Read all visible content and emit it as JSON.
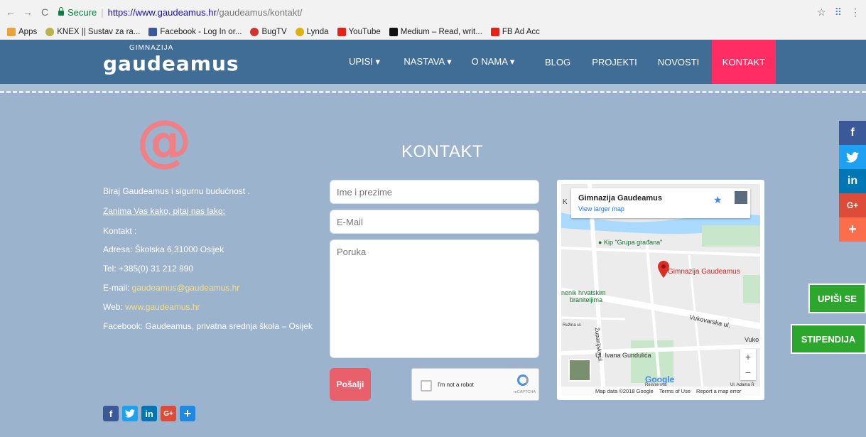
{
  "browser": {
    "secure_label": "Secure",
    "url_host": "https://www.gaudeamus.hr",
    "url_path": "/gaudeamus/kontakt/",
    "bookmarks": [
      "Apps",
      "KNEX || Sustav za ra...",
      "Facebook - Log In or...",
      "BugTV",
      "Lynda",
      "YouTube",
      "Medium – Read, writ...",
      "FB Ad Acc"
    ]
  },
  "header": {
    "logo_small": "GIMNAZIJA",
    "logo_big": "gaudeamus",
    "menu": [
      "UPISI ▾",
      "NASTAVA ▾",
      "O NAMA ▾",
      "BLOG",
      "PROJEKTI",
      "NOVOSTI",
      "KONTAKT"
    ]
  },
  "left": {
    "tagline": "Biraj Gaudeamus i sigurnu budućnost .",
    "ask_link": "Zanima Vas kako, pitaj nas lako:",
    "contact_label": "Kontakt :",
    "address": "Adresa: Školska 6,31000 Osijek",
    "tel": "Tel: +385(0) 31 212 890",
    "email_label": "E-mail: ",
    "email": "gaudeamus@gaudeamus.hr",
    "web_label": "Web: ",
    "web": "www.gaudeamus.hr",
    "facebook": "Facebook: Gaudeamus, privatna srednja škola – Osijek"
  },
  "form": {
    "title": "KONTAKT",
    "name_placeholder": "Ime i prezime",
    "email_placeholder": "E-Mail",
    "message_placeholder": "Poruka",
    "send_label": "Pošalji",
    "captcha_label": "I'm not a robot",
    "captcha_sub": "reCAPTCHA"
  },
  "map": {
    "place_title": "Gimnazija Gaudeamus",
    "larger_map": "View larger map",
    "k_label": "K",
    "poi_1": "Kip \"Grupa građana\"",
    "poi_red": "Gimnazija Gaudeamus",
    "poi_2a": "nenik hrvatskim",
    "poi_2b": "braniteljima",
    "street_1": "Vukovarska ul.",
    "street_1b": "Vuko",
    "street_2": "Ul. Ivana Gundulića",
    "street_3": "Ružina ul.",
    "street_4": "Županijska ul.",
    "street_5": "Reisnerova",
    "street_6": "Ul. Adama R",
    "google": "Google",
    "footer": [
      "Map data ©2018 Google",
      "Terms of Use",
      "Report a map error"
    ]
  },
  "social_right": [
    "f",
    "t",
    "in",
    "G+",
    "+"
  ],
  "float_buttons": {
    "enroll": "UPIŠI SE",
    "scholarship": "STIPENDIJA"
  },
  "social_bottom": [
    "f",
    "t",
    "in",
    "G+",
    "+"
  ],
  "colors": {
    "header_bg": "#3f6d96",
    "page_bg": "#9bb3cc",
    "active_menu": "#ff2d64",
    "accent_green": "#2ca62c"
  }
}
